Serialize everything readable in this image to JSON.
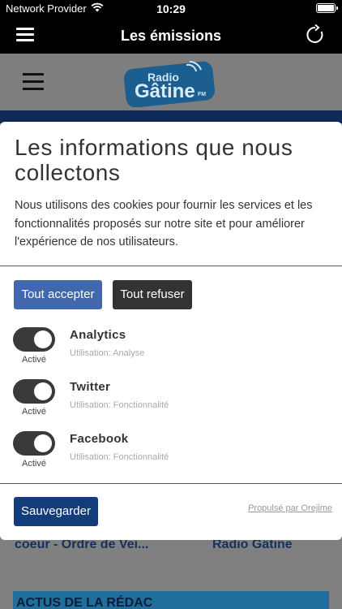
{
  "status_bar": {
    "carrier": "Network Provider",
    "time": "10:29"
  },
  "nav": {
    "title": "Les émissions",
    "icons": [
      "menu-icon",
      "refresh-icon"
    ]
  },
  "background": {
    "logo_text_top": "Radio",
    "logo_text_bottom": "Gâtine",
    "logo_suffix": "FM",
    "snippet_left": "coeur - Ordre de Vei...",
    "snippet_right": "Radio Gâtine",
    "banner_text": "ACTUS DE LA RÉDAC"
  },
  "consent": {
    "title": "Les informations que nous collectons",
    "description": "Nous utilisons des cookies pour fournir les services et les fonctionnalités proposés sur notre site et pour améliorer l'expérience de nos utilisateurs.",
    "accept_all_label": "Tout accepter",
    "refuse_all_label": "Tout refuser",
    "purposes": [
      {
        "name": "Analytics",
        "usage": "Utilisation: Analyse",
        "state_label": "Activé",
        "enabled": true
      },
      {
        "name": "Twitter",
        "usage": "Utilisation: Fonctionnalité",
        "state_label": "Activé",
        "enabled": true
      },
      {
        "name": "Facebook",
        "usage": "Utilisation: Fonctionnalité",
        "state_label": "Activé",
        "enabled": true
      }
    ],
    "save_label": "Sauvegarder",
    "powered_by": "Propulsé par Orejime"
  },
  "colors": {
    "accept": "#4168ad",
    "refuse": "#333333",
    "save": "#133c7a",
    "switch_on": "#3a3a3a"
  }
}
